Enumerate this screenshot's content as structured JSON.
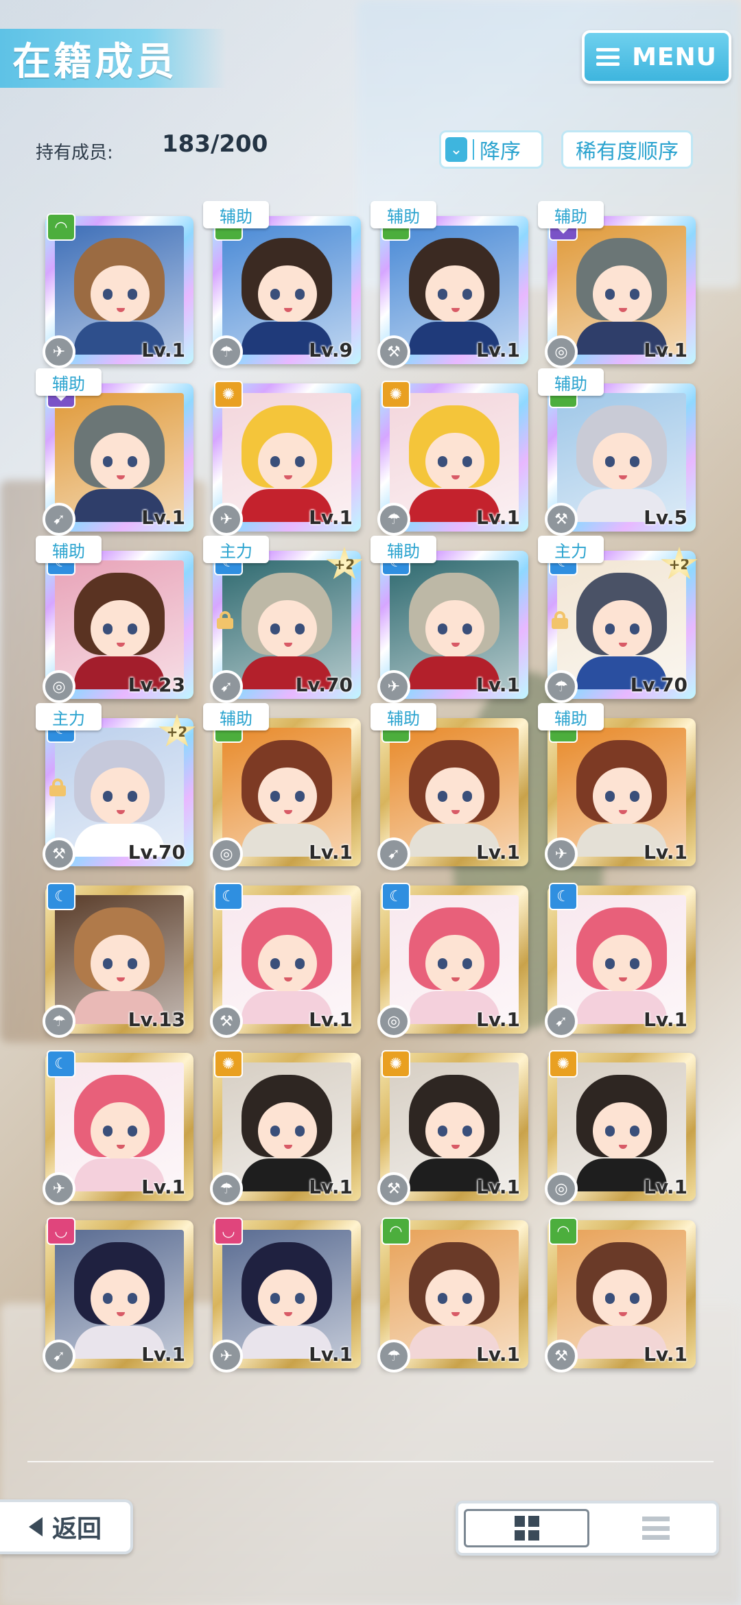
{
  "header": {
    "title": "在籍成员",
    "menu_label": "MENU"
  },
  "stats": {
    "owned_label": "持有成员:",
    "owned_count": "183/200"
  },
  "sort": {
    "order_label": "降序",
    "order_icon": "chevron-double-down-icon",
    "rarity_label": "稀有度顺序"
  },
  "attribute_colors": {
    "green": "#4cae3d",
    "purple": "#7a52c7",
    "orange": "#e9a021",
    "blue": "#2f8fe0",
    "pink": "#e0457c"
  },
  "cards": [
    {
      "tag": "",
      "plus": "",
      "locked": false,
      "level": "Lv.1",
      "frame": "rainbow",
      "attr": "green",
      "hair": "#9b6b42",
      "bg": "#3e6fb8",
      "outfit": "#2e4f8c"
    },
    {
      "tag": "辅助",
      "plus": "",
      "locked": false,
      "level": "Lv.9",
      "frame": "rainbow",
      "attr": "green",
      "hair": "#3b2a22",
      "bg": "#4a8ad6",
      "outfit": "#1f3a7a"
    },
    {
      "tag": "辅助",
      "plus": "",
      "locked": false,
      "level": "Lv.1",
      "frame": "rainbow",
      "attr": "green",
      "hair": "#3b2a22",
      "bg": "#4a8ad6",
      "outfit": "#1f3a7a"
    },
    {
      "tag": "辅助",
      "plus": "",
      "locked": false,
      "level": "Lv.1",
      "frame": "rainbow",
      "attr": "purple",
      "hair": "#6b7676",
      "bg": "#e09a3a",
      "outfit": "#2f3e6a"
    },
    {
      "tag": "辅助",
      "plus": "",
      "locked": false,
      "level": "Lv.1",
      "frame": "rainbow",
      "attr": "purple",
      "hair": "#6b7676",
      "bg": "#e09a3a",
      "outfit": "#2f3e6a"
    },
    {
      "tag": "",
      "plus": "",
      "locked": false,
      "level": "Lv.1",
      "frame": "rainbow",
      "attr": "orange",
      "hair": "#f4c53a",
      "bg": "#f3d6dc",
      "outfit": "#c4222d"
    },
    {
      "tag": "",
      "plus": "",
      "locked": false,
      "level": "Lv.1",
      "frame": "rainbow",
      "attr": "orange",
      "hair": "#f4c53a",
      "bg": "#f3d6dc",
      "outfit": "#c4222d"
    },
    {
      "tag": "辅助",
      "plus": "",
      "locked": false,
      "level": "Lv.5",
      "frame": "rainbow",
      "attr": "green",
      "hair": "#c9cbd6",
      "bg": "#9fc7e8",
      "outfit": "#e8e8f0"
    },
    {
      "tag": "辅助",
      "plus": "",
      "locked": false,
      "level": "Lv.23",
      "frame": "rainbow",
      "attr": "blue",
      "hair": "#5a3322",
      "bg": "#e8a3b8",
      "outfit": "#a31e2c"
    },
    {
      "tag": "主力",
      "plus": "+2",
      "locked": true,
      "level": "Lv.70",
      "frame": "rainbow",
      "attr": "blue",
      "hair": "#bdb8a6",
      "bg": "#2f6a70",
      "outfit": "#b3202b"
    },
    {
      "tag": "辅助",
      "plus": "",
      "locked": false,
      "level": "Lv.1",
      "frame": "rainbow",
      "attr": "blue",
      "hair": "#bdb8a6",
      "bg": "#2f6a70",
      "outfit": "#b3202b"
    },
    {
      "tag": "主力",
      "plus": "+2",
      "locked": true,
      "level": "Lv.70",
      "frame": "rainbow",
      "attr": "blue",
      "hair": "#4a5266",
      "bg": "#f2e6d4",
      "outfit": "#2a4fa0"
    },
    {
      "tag": "主力",
      "plus": "+2",
      "locked": true,
      "level": "Lv.70",
      "frame": "rainbow",
      "attr": "blue",
      "hair": "#c6c9db",
      "bg": "#bcd0ec",
      "outfit": "#ffffff"
    },
    {
      "tag": "辅助",
      "plus": "",
      "locked": false,
      "level": "Lv.1",
      "frame": "gold",
      "attr": "green",
      "hair": "#7d3a24",
      "bg": "#e88a2a",
      "outfit": "#e4e0d6"
    },
    {
      "tag": "辅助",
      "plus": "",
      "locked": false,
      "level": "Lv.1",
      "frame": "gold",
      "attr": "green",
      "hair": "#7d3a24",
      "bg": "#e88a2a",
      "outfit": "#e4e0d6"
    },
    {
      "tag": "辅助",
      "plus": "",
      "locked": false,
      "level": "Lv.1",
      "frame": "gold",
      "attr": "green",
      "hair": "#7d3a24",
      "bg": "#e88a2a",
      "outfit": "#e4e0d6"
    },
    {
      "tag": "",
      "plus": "",
      "locked": false,
      "level": "Lv.13",
      "frame": "gold",
      "attr": "blue",
      "hair": "#b07a4a",
      "bg": "#5a3d2a",
      "outfit": "#e9b9b6"
    },
    {
      "tag": "",
      "plus": "",
      "locked": false,
      "level": "Lv.1",
      "frame": "gold",
      "attr": "blue",
      "hair": "#e8607a",
      "bg": "#f8e8ee",
      "outfit": "#f4d0dc"
    },
    {
      "tag": "",
      "plus": "",
      "locked": false,
      "level": "Lv.1",
      "frame": "gold",
      "attr": "blue",
      "hair": "#e8607a",
      "bg": "#f8e8ee",
      "outfit": "#f4d0dc"
    },
    {
      "tag": "",
      "plus": "",
      "locked": false,
      "level": "Lv.1",
      "frame": "gold",
      "attr": "blue",
      "hair": "#e8607a",
      "bg": "#f8e8ee",
      "outfit": "#f4d0dc"
    },
    {
      "tag": "",
      "plus": "",
      "locked": false,
      "level": "Lv.1",
      "frame": "gold",
      "attr": "blue",
      "hair": "#e8607a",
      "bg": "#f8e8ee",
      "outfit": "#f4d0dc"
    },
    {
      "tag": "",
      "plus": "",
      "locked": false,
      "level": "Lv.1",
      "frame": "gold",
      "attr": "orange",
      "hair": "#2e2622",
      "bg": "#d7cfc4",
      "outfit": "#1e1e1e"
    },
    {
      "tag": "",
      "plus": "",
      "locked": false,
      "level": "Lv.1",
      "frame": "gold",
      "attr": "orange",
      "hair": "#2e2622",
      "bg": "#d7cfc4",
      "outfit": "#1e1e1e"
    },
    {
      "tag": "",
      "plus": "",
      "locked": false,
      "level": "Lv.1",
      "frame": "gold",
      "attr": "orange",
      "hair": "#2e2622",
      "bg": "#d7cfc4",
      "outfit": "#1e1e1e"
    },
    {
      "tag": "",
      "plus": "",
      "locked": false,
      "level": "Lv.1",
      "frame": "gold",
      "attr": "pink",
      "hair": "#1f2140",
      "bg": "#5a6c92",
      "outfit": "#e9e4ec"
    },
    {
      "tag": "",
      "plus": "",
      "locked": false,
      "level": "Lv.1",
      "frame": "gold",
      "attr": "pink",
      "hair": "#1f2140",
      "bg": "#5a6c92",
      "outfit": "#e9e4ec"
    },
    {
      "tag": "",
      "plus": "",
      "locked": false,
      "level": "Lv.1",
      "frame": "gold",
      "attr": "green",
      "hair": "#6a3a28",
      "bg": "#e8a35a",
      "outfit": "#f2d6d6"
    },
    {
      "tag": "",
      "plus": "",
      "locked": false,
      "level": "Lv.1",
      "frame": "gold",
      "attr": "green",
      "hair": "#6a3a28",
      "bg": "#e8a35a",
      "outfit": "#f2d6d6"
    }
  ],
  "footer": {
    "back_label": "返回",
    "view_grid_icon": "grid-icon",
    "view_list_icon": "list-icon"
  }
}
